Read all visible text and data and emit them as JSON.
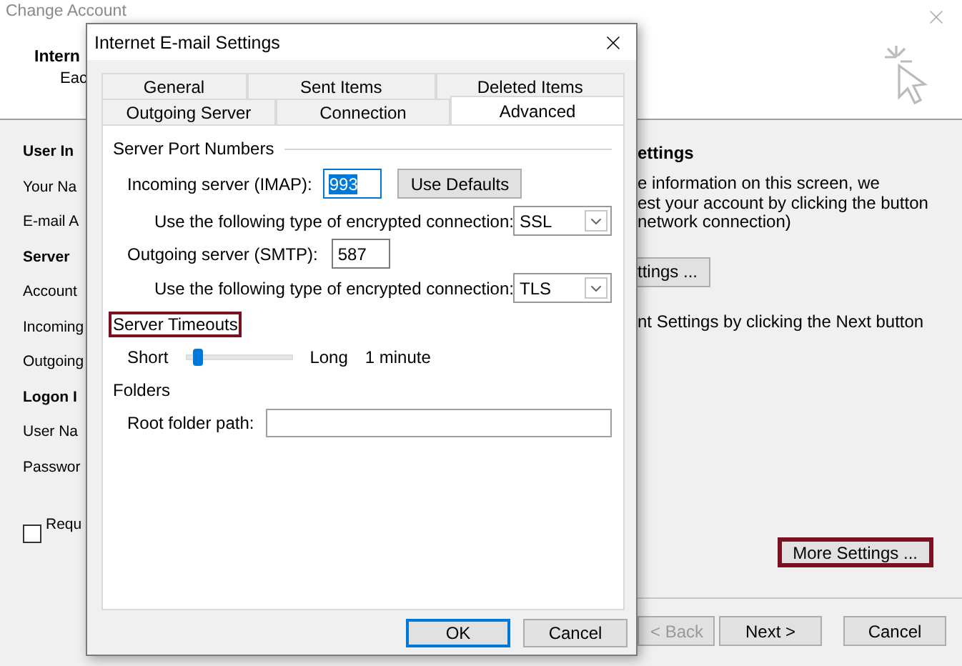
{
  "background_window": {
    "title": "Change Account",
    "header_title": "Intern",
    "header_subtitle": "Eac",
    "left_labels": [
      {
        "text": "User In",
        "kind": "heading"
      },
      {
        "text": "Your Na",
        "kind": "label"
      },
      {
        "text": "E-mail A",
        "kind": "label"
      },
      {
        "text": "Server",
        "kind": "heading"
      },
      {
        "text": "Account",
        "kind": "label"
      },
      {
        "text": "Incoming",
        "kind": "label"
      },
      {
        "text": "Outgoing",
        "kind": "label"
      },
      {
        "text": "Logon I",
        "kind": "heading"
      },
      {
        "text": "User Na",
        "kind": "label"
      },
      {
        "text": "Passwor",
        "kind": "label"
      },
      {
        "text": "Requ",
        "kind": "checkbox",
        "checked": false
      }
    ],
    "right_panel": {
      "heading": "ettings",
      "description": [
        "e information on this screen, we",
        "est your account by clicking the button",
        "network connection)"
      ],
      "test_button": "ttings ...",
      "next_hint": "nt Settings by clicking the Next button",
      "more_settings": {
        "label": "More Settings ...",
        "highlighted": true
      }
    },
    "buttons": [
      {
        "label": "< Back",
        "disabled": true
      },
      {
        "label": "Next >",
        "disabled": false
      },
      {
        "label": "Cancel",
        "disabled": false
      }
    ]
  },
  "dialog": {
    "title": "Internet E-mail Settings",
    "tab_rows": [
      [
        {
          "label": "General",
          "selected": false
        },
        {
          "label": "Sent Items",
          "selected": false
        },
        {
          "label": "Deleted Items",
          "selected": false
        }
      ],
      [
        {
          "label": "Outgoing Server",
          "selected": false
        },
        {
          "label": "Connection",
          "selected": false
        },
        {
          "label": "Advanced",
          "selected": true
        }
      ]
    ],
    "server_port_numbers": {
      "title": "Server Port Numbers",
      "highlighted": false,
      "incoming_label": "Incoming server (IMAP):",
      "incoming_value": "993",
      "use_defaults": "Use Defaults",
      "incoming_encryption_label": "Use the following type of encrypted connection:",
      "incoming_encryption": "SSL",
      "outgoing_label": "Outgoing server (SMTP):",
      "outgoing_value": "587",
      "outgoing_encryption_label": "Use the following type of encrypted connection:",
      "outgoing_encryption": "TLS"
    },
    "server_timeouts": {
      "title": "Server Timeouts",
      "highlighted": true,
      "short_label": "Short",
      "long_label": "Long",
      "level": 0.1,
      "reading": "1 minute"
    },
    "folders": {
      "title": "Folders",
      "highlighted": false,
      "root_label": "Root folder path:"
    },
    "buttons": [
      {
        "label": "OK",
        "default": true
      },
      {
        "label": "Cancel",
        "default": false
      }
    ]
  }
}
